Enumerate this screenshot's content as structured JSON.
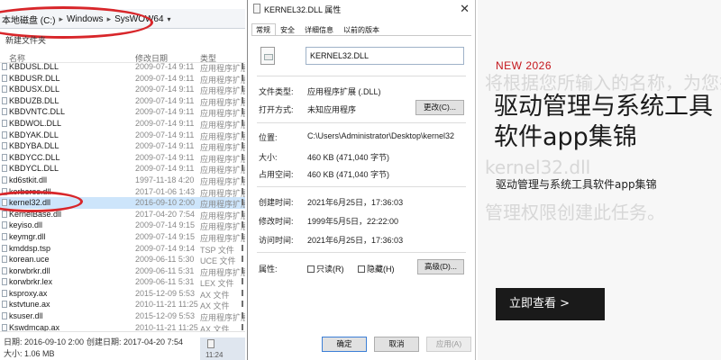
{
  "explorer": {
    "address": {
      "drive": "本地磁盘 (C:)",
      "folder1": "Windows",
      "folder2": "SysWOW64",
      "sep": "▸",
      "chevron": "▾"
    },
    "toolbar_label": "新建文件夹",
    "columns": {
      "name": "名称",
      "date": "修改日期",
      "type": "类型"
    },
    "files": [
      {
        "name": "KBDUSL.DLL",
        "date": "2009-07-14 9:11",
        "type": "应用程序扩展"
      },
      {
        "name": "KBDUSR.DLL",
        "date": "2009-07-14 9:11",
        "type": "应用程序扩展"
      },
      {
        "name": "KBDUSX.DLL",
        "date": "2009-07-14 9:11",
        "type": "应用程序扩展"
      },
      {
        "name": "KBDUZB.DLL",
        "date": "2009-07-14 9:11",
        "type": "应用程序扩展"
      },
      {
        "name": "KBDVNTC.DLL",
        "date": "2009-07-14 9:11",
        "type": "应用程序扩展"
      },
      {
        "name": "KBDWOL.DLL",
        "date": "2009-07-14 9:11",
        "type": "应用程序扩展"
      },
      {
        "name": "KBDYAK.DLL",
        "date": "2009-07-14 9:11",
        "type": "应用程序扩展"
      },
      {
        "name": "KBDYBA.DLL",
        "date": "2009-07-14 9:11",
        "type": "应用程序扩展"
      },
      {
        "name": "KBDYCC.DLL",
        "date": "2009-07-14 9:11",
        "type": "应用程序扩展"
      },
      {
        "name": "KBDYCL.DLL",
        "date": "2009-07-14 9:11",
        "type": "应用程序扩展"
      },
      {
        "name": "kd6stkit.dll",
        "date": "1997-11-18 4:20",
        "type": "应用程序扩展"
      },
      {
        "name": "kerberos.dll",
        "date": "2017-01-06 1:43",
        "type": "应用程序扩展"
      },
      {
        "name": "kernel32.dll",
        "date": "2016-09-10 2:00",
        "type": "应用程序扩展",
        "selected": true
      },
      {
        "name": "KernelBase.dll",
        "date": "2017-04-20 7:54",
        "type": "应用程序扩展"
      },
      {
        "name": "keyiso.dll",
        "date": "2009-07-14 9:15",
        "type": "应用程序扩展"
      },
      {
        "name": "keymgr.dll",
        "date": "2009-07-14 9:15",
        "type": "应用程序扩展"
      },
      {
        "name": "kmddsp.tsp",
        "date": "2009-07-14 9:14",
        "type": "TSP 文件"
      },
      {
        "name": "korean.uce",
        "date": "2009-06-11 5:30",
        "type": "UCE 文件"
      },
      {
        "name": "korwbrkr.dll",
        "date": "2009-06-11 5:31",
        "type": "应用程序扩展"
      },
      {
        "name": "korwbrkr.lex",
        "date": "2009-06-11 5:31",
        "type": "LEX 文件"
      },
      {
        "name": "ksproxy.ax",
        "date": "2015-12-09 5:53",
        "type": "AX 文件"
      },
      {
        "name": "kstvtune.ax",
        "date": "2010-11-21 11:25",
        "type": "AX 文件"
      },
      {
        "name": "ksuser.dll",
        "date": "2015-12-09 5:53",
        "type": "应用程序扩展"
      },
      {
        "name": "Kswdmcap.ax",
        "date": "2010-11-21 11:25",
        "type": "AX 文件"
      }
    ],
    "status": {
      "modified": "日期: 2016-09-10 2:00",
      "created": "创建日期: 2017-04-20 7:54",
      "size": "大小: 1.06 MB",
      "taskbar_time": "11:24"
    }
  },
  "dialog": {
    "title": "KERNEL32.DLL 属性",
    "close": "✕",
    "tabs": [
      "常规",
      "安全",
      "详细信息",
      "以前的版本"
    ],
    "filename": "KERNEL32.DLL",
    "props": {
      "filetype_label": "文件类型:",
      "filetype_value": "应用程序扩展 (.DLL)",
      "openwith_label": "打开方式:",
      "openwith_value": "未知应用程序",
      "change_btn": "更改(C)...",
      "location_label": "位置:",
      "location_value": "C:\\Users\\Administrator\\Desktop\\kernel32",
      "size_label": "大小:",
      "size_value": "460 KB (471,040 字节)",
      "disk_label": "占用空间:",
      "disk_value": "460 KB (471,040 字节)",
      "created_label": "创建时间:",
      "created_value": "2021年6月25日，17:36:03",
      "modified_label": "修改时间:",
      "modified_value": "1999年5月5日，22:22:00",
      "accessed_label": "访问时间:",
      "accessed_value": "2021年6月25日，17:36:03",
      "attr_label": "属性:",
      "readonly_label": "只读(R)",
      "hidden_label": "隐藏(H)",
      "advanced_btn": "高级(D)..."
    },
    "footer": {
      "ok": "确定",
      "cancel": "取消",
      "apply": "应用(A)"
    }
  },
  "promo": {
    "ghost1": "将根据您所输入的名称，为您打",
    "ghost2": "kernel32.dll",
    "ghost3": "管理权限创建此任务。",
    "tag": "NEW 2026",
    "headline": "驱动管理与系统工具软件app集锦",
    "subline": "驱动管理与系统工具软件app集锦",
    "cta": "立即查看 >",
    "accent_color": "#c4161c"
  }
}
